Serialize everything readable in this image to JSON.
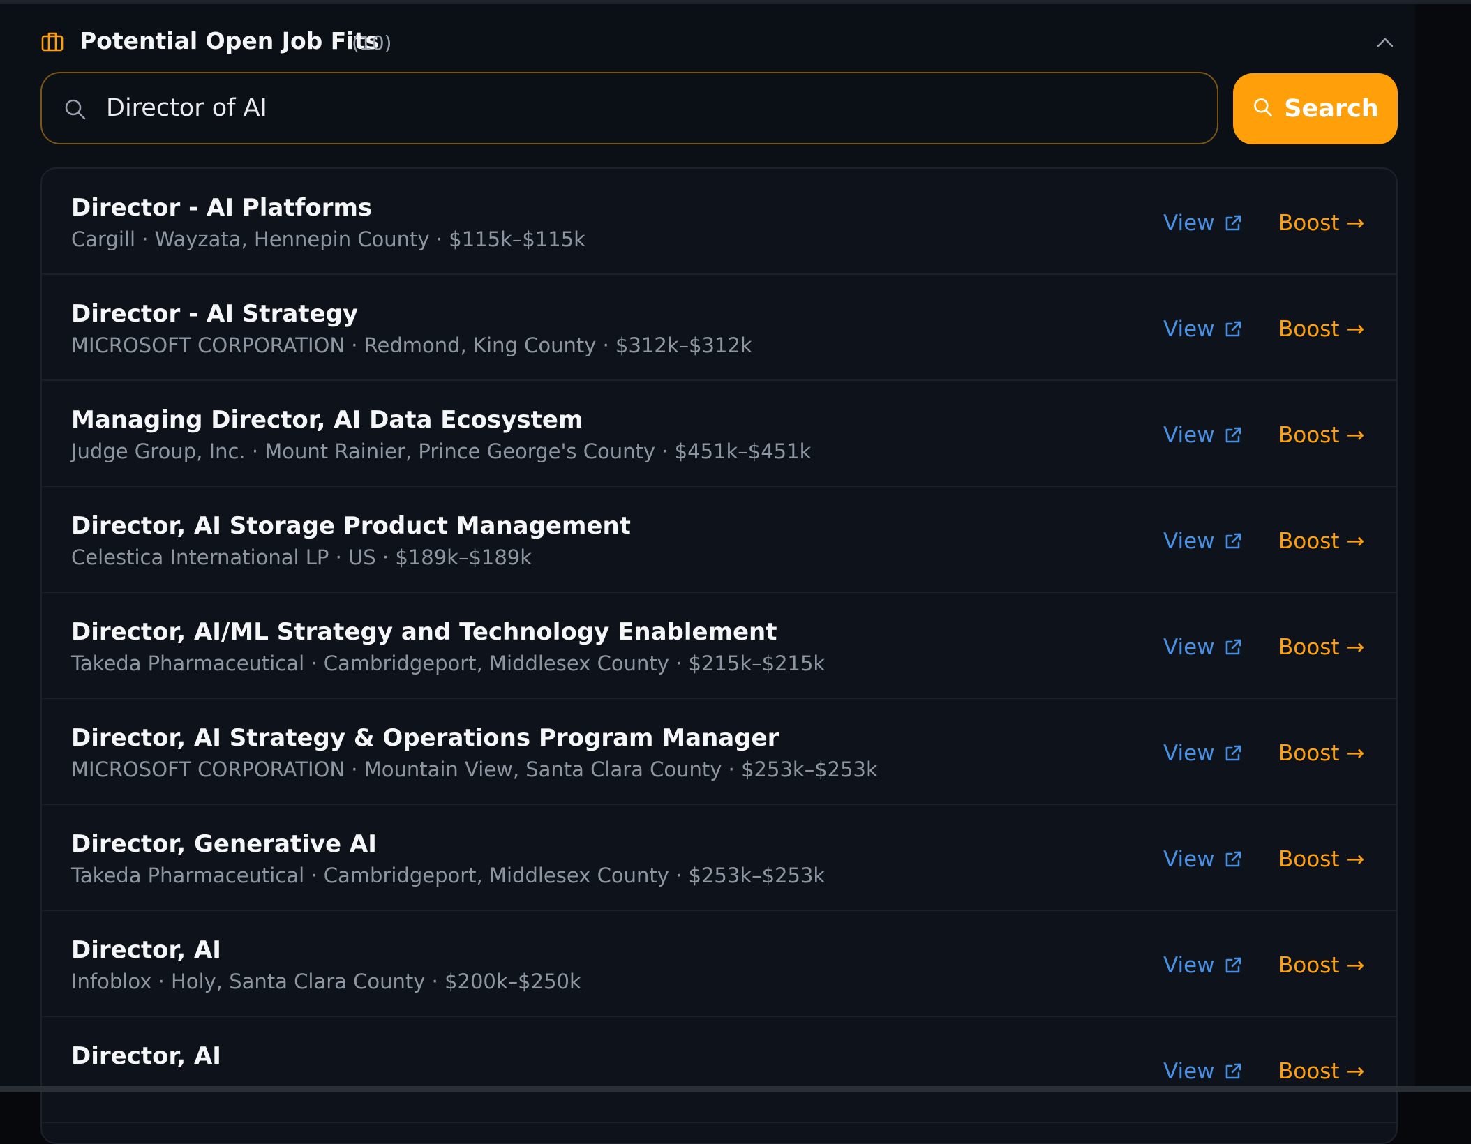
{
  "section": {
    "title": "Potential Open Job Fits",
    "count": "(10)",
    "icon": "briefcase-icon",
    "collapse_icon": "chevron-up-icon"
  },
  "search": {
    "value": "Director of AI",
    "button_label": "Search",
    "icon": "search-icon"
  },
  "colors": {
    "accent": "#ff9f0a",
    "link": "#4a90e2",
    "background": "#0b0f16"
  },
  "jobs": [
    {
      "title": "Director - AI Platforms",
      "meta": "Cargill · Wayzata, Hennepin County · $115k–$115k",
      "view_label": "View",
      "boost_label": "Boost →"
    },
    {
      "title": "Director - AI Strategy",
      "meta": "MICROSOFT CORPORATION · Redmond, King County · $312k–$312k",
      "view_label": "View",
      "boost_label": "Boost →"
    },
    {
      "title": "Managing Director, AI Data Ecosystem",
      "meta": "Judge Group, Inc. · Mount Rainier, Prince George's County · $451k–$451k",
      "view_label": "View",
      "boost_label": "Boost →"
    },
    {
      "title": "Director, AI Storage Product Management",
      "meta": "Celestica International LP · US · $189k–$189k",
      "view_label": "View",
      "boost_label": "Boost →"
    },
    {
      "title": "Director, AI/ML Strategy and Technology Enablement",
      "meta": "Takeda Pharmaceutical · Cambridgeport, Middlesex County · $215k–$215k",
      "view_label": "View",
      "boost_label": "Boost →"
    },
    {
      "title": "Director, AI Strategy & Operations Program Manager",
      "meta": "MICROSOFT CORPORATION · Mountain View, Santa Clara County · $253k–$253k",
      "view_label": "View",
      "boost_label": "Boost →"
    },
    {
      "title": "Director, Generative AI",
      "meta": "Takeda Pharmaceutical · Cambridgeport, Middlesex County · $253k–$253k",
      "view_label": "View",
      "boost_label": "Boost →"
    },
    {
      "title": "Director, AI",
      "meta": "Infoblox · Holy, Santa Clara County · $200k–$250k",
      "view_label": "View",
      "boost_label": "Boost →"
    },
    {
      "title": "Director, AI",
      "meta": "",
      "view_label": "View",
      "boost_label": "Boost →"
    }
  ]
}
